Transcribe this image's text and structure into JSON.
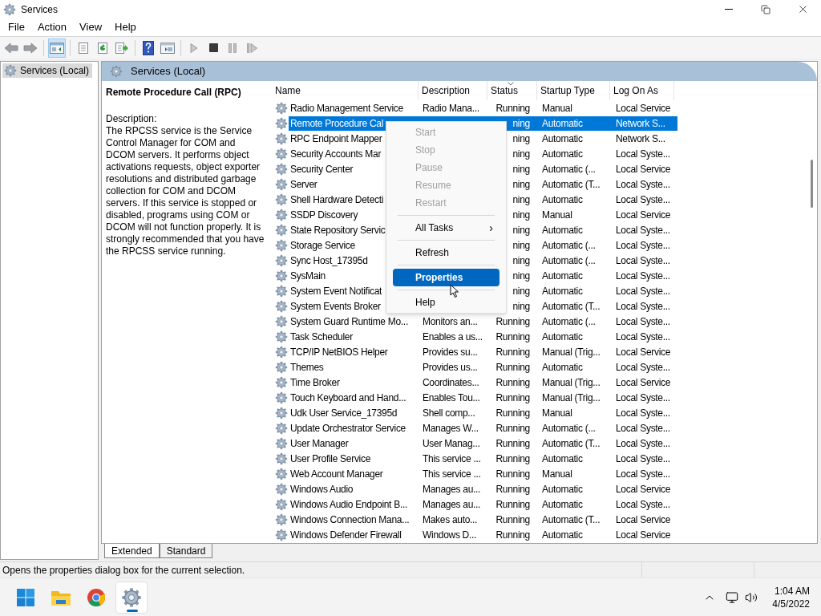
{
  "window": {
    "title": "Services"
  },
  "menu": [
    "File",
    "Action",
    "View",
    "Help"
  ],
  "toolbar": [
    [
      {
        "kind": "back",
        "pressed": false
      },
      {
        "kind": "forward",
        "pressed": false
      }
    ],
    [
      {
        "kind": "tree",
        "pressed": true
      }
    ],
    [
      {
        "kind": "sheet",
        "pressed": false
      },
      {
        "kind": "refresh",
        "pressed": false
      },
      {
        "kind": "export",
        "pressed": false
      }
    ],
    [
      {
        "kind": "help",
        "pressed": false
      },
      {
        "kind": "view",
        "pressed": false
      }
    ],
    [
      {
        "kind": "play",
        "pressed": false
      },
      {
        "kind": "stop",
        "pressed": false
      },
      {
        "kind": "pause",
        "pressed": false
      },
      {
        "kind": "resume",
        "pressed": false
      }
    ]
  ],
  "tree": [
    {
      "label": "Services (Local)",
      "selected": true
    }
  ],
  "panel": {
    "title": "Services (Local)"
  },
  "details": {
    "heading": "Remote Procedure Call (RPC)",
    "label": "Description:",
    "text": "The RPCSS service is the Service Control Manager for COM and DCOM servers. It performs object activations requests, object exporter resolutions and distributed garbage collection for COM and DCOM servers. If this service is stopped or disabled, programs using COM or DCOM will not function properly. It is strongly recommended that you have the RPCSS service running."
  },
  "table": {
    "columns": [
      {
        "label": "Name",
        "sorted": false
      },
      {
        "label": "Description",
        "sorted": false
      },
      {
        "label": "Status",
        "sorted": true
      },
      {
        "label": "Startup Type",
        "sorted": false
      },
      {
        "label": "Log On As",
        "sorted": false
      }
    ],
    "rows": [
      {
        "name": "Radio Management Service",
        "description": "Radio Mana...",
        "status": "Running",
        "startup": "Manual",
        "logon": "Local Service",
        "selected": false
      },
      {
        "name": "Remote Procedure Cal",
        "status": "ning",
        "startup": "Automatic",
        "logon": "Network S...",
        "selected": true
      },
      {
        "name": "RPC Endpoint Mapper",
        "status": "ning",
        "startup": "Automatic",
        "logon": "Network S...",
        "selected": false
      },
      {
        "name": "Security Accounts Mar",
        "status": "ning",
        "startup": "Automatic",
        "logon": "Local Syste...",
        "selected": false
      },
      {
        "name": "Security Center",
        "status": "ning",
        "startup": "Automatic (...",
        "logon": "Local Service",
        "selected": false
      },
      {
        "name": "Server",
        "status": "ning",
        "startup": "Automatic (T...",
        "logon": "Local Syste...",
        "selected": false
      },
      {
        "name": "Shell Hardware Detecti",
        "status": "ning",
        "startup": "Automatic",
        "logon": "Local Syste...",
        "selected": false
      },
      {
        "name": "SSDP Discovery",
        "status": "ning",
        "startup": "Manual",
        "logon": "Local Service",
        "selected": false
      },
      {
        "name": "State Repository Servic",
        "status": "ning",
        "startup": "Automatic",
        "logon": "Local Syste...",
        "selected": false
      },
      {
        "name": "Storage Service",
        "status": "ning",
        "startup": "Automatic (...",
        "logon": "Local Syste...",
        "selected": false
      },
      {
        "name": "Sync Host_17395d",
        "status": "ning",
        "startup": "Automatic (...",
        "logon": "Local Syste...",
        "selected": false
      },
      {
        "name": "SysMain",
        "status": "ning",
        "startup": "Automatic",
        "logon": "Local Syste...",
        "selected": false
      },
      {
        "name": "System Event Notificat",
        "status": "ning",
        "startup": "Automatic",
        "logon": "Local Syste...",
        "selected": false
      },
      {
        "name": "System Events Broker",
        "status": "ning",
        "startup": "Automatic (T...",
        "logon": "Local Syste...",
        "selected": false
      },
      {
        "name": "System Guard Runtime Mo...",
        "description": "Monitors an...",
        "status": "Running",
        "startup": "Automatic (...",
        "logon": "Local Syste...",
        "selected": false
      },
      {
        "name": "Task Scheduler",
        "description": "Enables a us...",
        "status": "Running",
        "startup": "Automatic",
        "logon": "Local Syste...",
        "selected": false
      },
      {
        "name": "TCP/IP NetBIOS Helper",
        "description": "Provides su...",
        "status": "Running",
        "startup": "Manual (Trig...",
        "logon": "Local Service",
        "selected": false
      },
      {
        "name": "Themes",
        "description": "Provides us...",
        "status": "Running",
        "startup": "Automatic",
        "logon": "Local Syste...",
        "selected": false
      },
      {
        "name": "Time Broker",
        "description": "Coordinates...",
        "status": "Running",
        "startup": "Manual (Trig...",
        "logon": "Local Service",
        "selected": false
      },
      {
        "name": "Touch Keyboard and Hand...",
        "description": "Enables Tou...",
        "status": "Running",
        "startup": "Manual (Trig...",
        "logon": "Local Syste...",
        "selected": false
      },
      {
        "name": "Udk User Service_17395d",
        "description": "Shell comp...",
        "status": "Running",
        "startup": "Manual",
        "logon": "Local Syste...",
        "selected": false
      },
      {
        "name": "Update Orchestrator Service",
        "description": "Manages W...",
        "status": "Running",
        "startup": "Automatic (...",
        "logon": "Local Syste...",
        "selected": false
      },
      {
        "name": "User Manager",
        "description": "User Manag...",
        "status": "Running",
        "startup": "Automatic (T...",
        "logon": "Local Syste...",
        "selected": false
      },
      {
        "name": "User Profile Service",
        "description": "This service ...",
        "status": "Running",
        "startup": "Automatic",
        "logon": "Local Syste...",
        "selected": false
      },
      {
        "name": "Web Account Manager",
        "description": "This service ...",
        "status": "Running",
        "startup": "Manual",
        "logon": "Local Syste...",
        "selected": false
      },
      {
        "name": "Windows Audio",
        "description": "Manages au...",
        "status": "Running",
        "startup": "Automatic",
        "logon": "Local Service",
        "selected": false
      },
      {
        "name": "Windows Audio Endpoint B...",
        "description": "Manages au...",
        "status": "Running",
        "startup": "Automatic",
        "logon": "Local Syste...",
        "selected": false
      },
      {
        "name": "Windows Connection Mana...",
        "description": "Makes auto...",
        "status": "Running",
        "startup": "Automatic (T...",
        "logon": "Local Service",
        "selected": false
      },
      {
        "name": "Windows Defender Firewall",
        "description": "Windows D...",
        "status": "Running",
        "startup": "Automatic",
        "logon": "Local Service",
        "selected": false
      }
    ]
  },
  "context_menu": [
    {
      "kind": "item",
      "label": "Start",
      "disabled": true,
      "selected": false
    },
    {
      "kind": "item",
      "label": "Stop",
      "disabled": true,
      "selected": false
    },
    {
      "kind": "item",
      "label": "Pause",
      "disabled": true,
      "selected": false
    },
    {
      "kind": "item",
      "label": "Resume",
      "disabled": true,
      "selected": false
    },
    {
      "kind": "item",
      "label": "Restart",
      "disabled": true,
      "selected": false
    },
    {
      "kind": "separator"
    },
    {
      "kind": "submenu",
      "label": "All Tasks",
      "arrow": "›",
      "disabled": false,
      "selected": false
    },
    {
      "kind": "separator"
    },
    {
      "kind": "item",
      "label": "Refresh",
      "disabled": false,
      "selected": false
    },
    {
      "kind": "separator"
    },
    {
      "kind": "item",
      "label": "Properties",
      "disabled": false,
      "selected": true
    },
    {
      "kind": "separator"
    },
    {
      "kind": "item",
      "label": "Help",
      "disabled": false,
      "selected": false
    }
  ],
  "tabs": [
    {
      "label": "Extended",
      "selected": true
    },
    {
      "label": "Standard",
      "selected": false
    }
  ],
  "status_bar": {
    "text": "Opens the properties dialog box for the current selection."
  },
  "taskbar": {
    "apps": [
      {
        "kind": "start",
        "active": false
      },
      {
        "kind": "folder",
        "active": false
      },
      {
        "kind": "chrome",
        "active": false
      },
      {
        "kind": "services",
        "active": true
      }
    ],
    "time": "1:04 AM",
    "date": "4/5/2022"
  }
}
